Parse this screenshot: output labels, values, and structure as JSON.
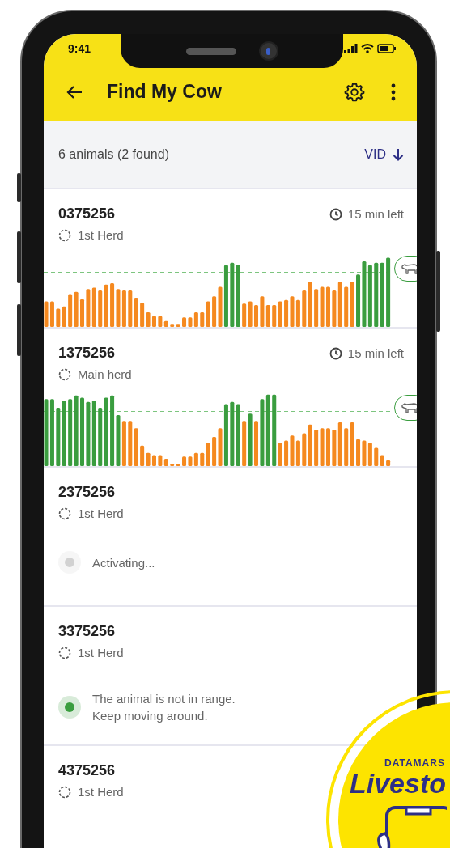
{
  "status_bar": {
    "time": "9:41"
  },
  "app_bar": {
    "title": "Find My Cow"
  },
  "list_header": {
    "summary": "6 animals (2 found)",
    "sort": {
      "label": "VID"
    }
  },
  "animals": [
    {
      "vid": "0375256",
      "herd": "1st Herd",
      "time_left": "15 min left",
      "kind": "chart"
    },
    {
      "vid": "1375256",
      "herd": "Main herd",
      "time_left": "15 min left",
      "kind": "chart"
    },
    {
      "vid": "2375256",
      "herd": "1st Herd",
      "kind": "status",
      "status": {
        "lines": [
          "Activating..."
        ],
        "color": "#d2d2d2"
      }
    },
    {
      "vid": "3375256",
      "herd": "1st Herd",
      "kind": "status",
      "status": {
        "lines": [
          "The animal is not in range.",
          "Keep moving around."
        ],
        "color": "#3a9d3f"
      }
    },
    {
      "vid": "4375256",
      "herd": "1st Herd",
      "kind": "plain"
    }
  ],
  "badge": {
    "brand": "DATAMARS",
    "product": "Livesto"
  }
}
